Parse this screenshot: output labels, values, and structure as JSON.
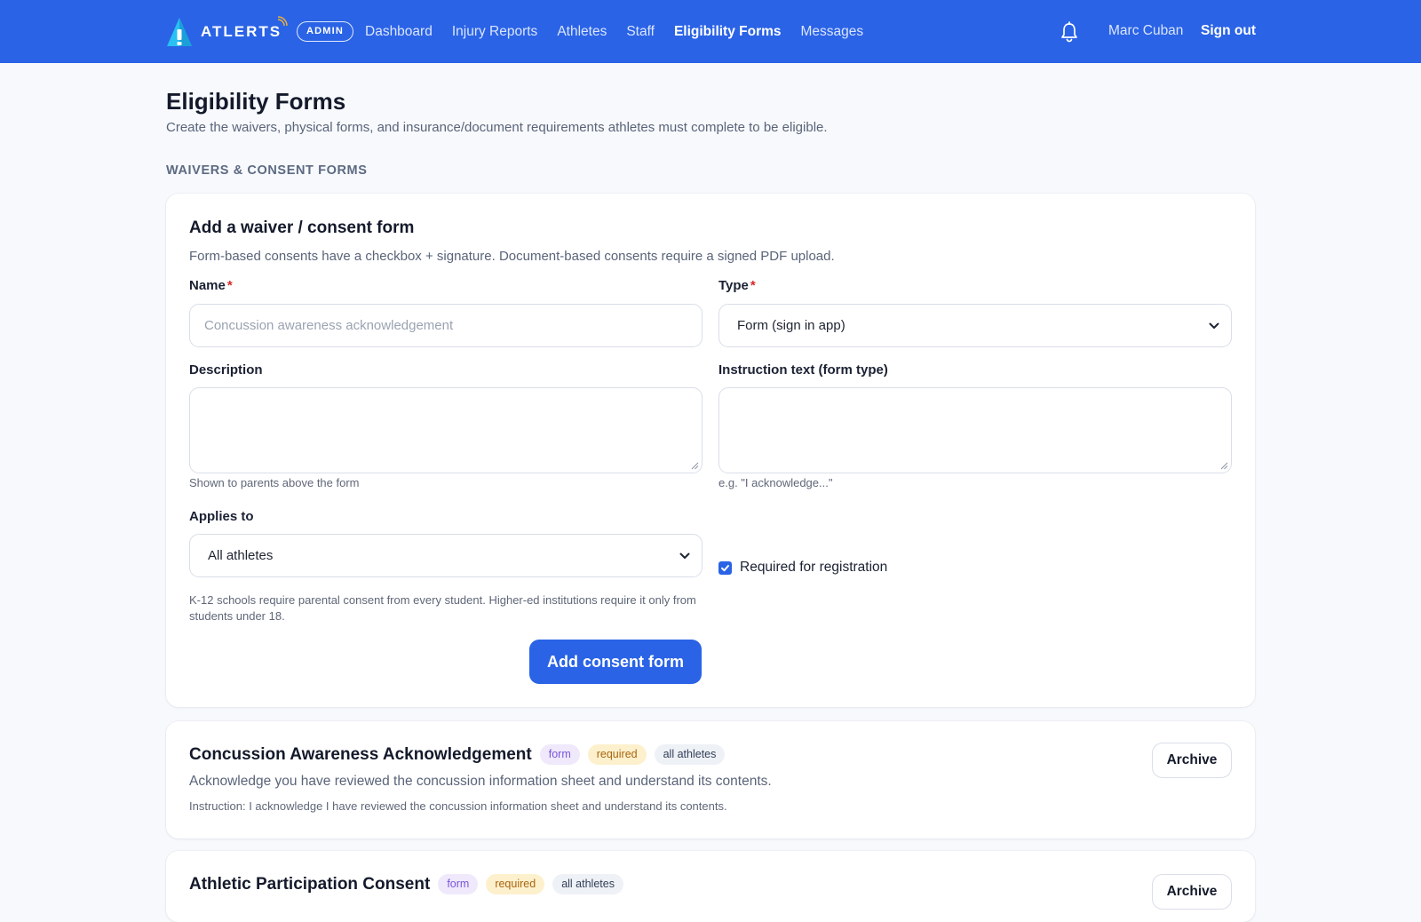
{
  "brand": {
    "name": "ATLERTS",
    "badge": "ADMIN"
  },
  "nav": {
    "items": [
      {
        "label": "Dashboard"
      },
      {
        "label": "Injury Reports"
      },
      {
        "label": "Athletes"
      },
      {
        "label": "Staff"
      },
      {
        "label": "Eligibility Forms",
        "active": true
      },
      {
        "label": "Messages"
      }
    ],
    "user_name": "Marc Cuban",
    "sign_out": "Sign out"
  },
  "page": {
    "title": "Eligibility Forms",
    "subtitle": "Create the waivers, physical forms, and insurance/document requirements athletes must complete to be eligible.",
    "section_label": "WAIVERS & CONSENT FORMS"
  },
  "form": {
    "title": "Add a waiver / consent form",
    "subtitle": "Form-based consents have a checkbox + signature. Document-based consents require a signed PDF upload.",
    "name_label": "Name",
    "name_placeholder": "Concussion awareness acknowledgement",
    "name_value": "",
    "type_label": "Type",
    "type_value": "Form (sign in app)",
    "description_label": "Description",
    "description_value": "",
    "description_hint": "Shown to parents above the form",
    "instruction_label": "Instruction text (form type)",
    "instruction_value": "",
    "instruction_hint": "e.g. \"I acknowledge...\"",
    "applies_label": "Applies to",
    "applies_value": "All athletes",
    "applies_hint": "K-12 schools require parental consent from every student. Higher-ed institutions require it only from students under 18.",
    "required_label": "Required for registration",
    "required_checked": true,
    "submit_label": "Add consent form",
    "required_marker": "*"
  },
  "consents": [
    {
      "title": "Concussion Awareness Acknowledgement",
      "badges": [
        "form",
        "required",
        "all athletes"
      ],
      "description": "Acknowledge you have reviewed the concussion information sheet and understand its contents.",
      "instruction": "Instruction: I acknowledge I have reviewed the concussion information sheet and understand its contents.",
      "archive_label": "Archive"
    },
    {
      "title": "Athletic Participation Consent",
      "badges": [
        "form",
        "required",
        "all athletes"
      ],
      "archive_label": "Archive"
    }
  ],
  "colors": {
    "primary": "#2a63e6",
    "badge_form": "#7b55d8",
    "badge_required": "#a8660f",
    "required_marker": "#d62929"
  },
  "icons": {
    "bell": "bell-icon",
    "logo": "atlerts-logo-icon",
    "chevron": "chevron-down-icon",
    "check": "checkmark-icon"
  }
}
